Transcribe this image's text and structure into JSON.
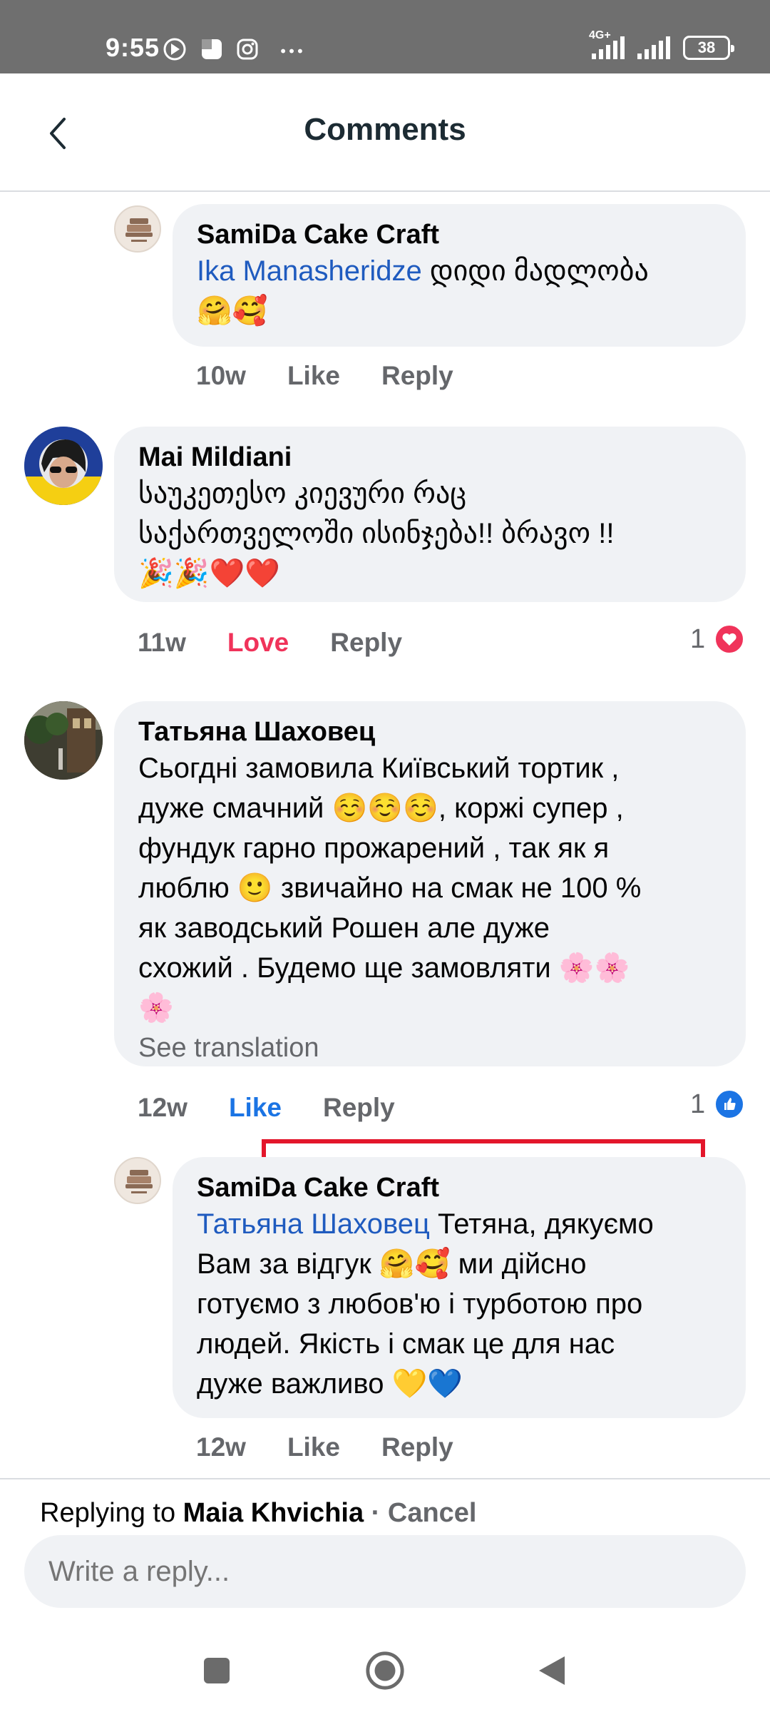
{
  "status_bar": {
    "time": "9:55",
    "network": "4G+",
    "battery": "38"
  },
  "header": {
    "title": "Comments"
  },
  "comments": [
    {
      "author": "SamiDa Cake Craft",
      "mention": "Ika Manasheridze",
      "text": " დიდი მადლობა",
      "emoji": "🤗🥰",
      "time": "10w",
      "like": "Like",
      "reply": "Reply"
    },
    {
      "author": "Mai Mildiani",
      "text_line1": "საუკეთესო კიევური რაც",
      "text_line2": "საქართველოში ისინჯება!! ბრავო !!",
      "emoji": "🎉🎉❤️❤️",
      "time": "11w",
      "like": "Love",
      "reply": "Reply",
      "reaction_count": "1"
    },
    {
      "author": "Татьяна Шаховец",
      "lines": [
        "Сьогдні замовила Київський тортик ,",
        "дуже смачний ☺️☺️☺️, коржі супер ,",
        "фундук гарно прожарений , так як я",
        "люблю 🙂 звичайно на смак не 100 %",
        "як заводський Рошен але дуже",
        "схожий . Будемо ще замовляти 🌸🌸",
        "🌸"
      ],
      "see_translation": "See translation",
      "time": "12w",
      "like": "Like",
      "reply": "Reply",
      "reaction_count": "1"
    },
    {
      "author": "SamiDa Cake Craft",
      "mention": "Татьяна Шаховец",
      "lines": [
        " Тетяна, дякуємо",
        "Вам за відгук 🤗🥰 ми дійсно",
        "готуємо з любов'ю і турботою про",
        "людей. Якість і смак це для нас",
        "дуже важливо 💛💙"
      ],
      "time": "12w",
      "like": "Like",
      "reply": "Reply"
    }
  ],
  "reply_bar": {
    "prefix": "Replying to ",
    "name": "Maia Khvichia",
    "separator": " · ",
    "cancel": "Cancel",
    "placeholder": "Write a reply..."
  },
  "colors": {
    "status_bar": "#6f6f6f",
    "bubble": "#f0f2f5",
    "mention": "#1f5bbf",
    "love": "#f0335a",
    "like_active": "#1b74e4",
    "highlight": "#e3162b"
  }
}
